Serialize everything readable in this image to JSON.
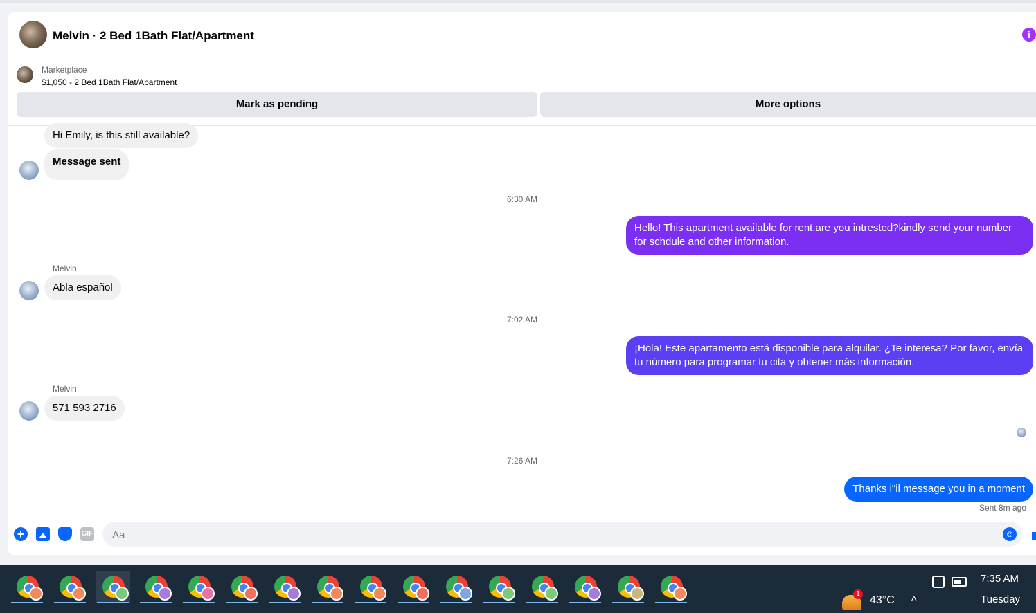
{
  "header": {
    "title": "Melvin · 2 Bed 1Bath Flat/Apartment",
    "info_icon": "i"
  },
  "marketplace": {
    "label": "Marketplace",
    "listing": "$1,050 - 2 Bed 1Bath Flat/Apartment",
    "mark_pending_label": "Mark as pending",
    "more_options_label": "More options"
  },
  "messages": [
    {
      "direction": "in",
      "text": "Hi Emily, is this still available?"
    },
    {
      "direction": "in",
      "text": "Message sent"
    },
    {
      "timestamp": "6:30 AM"
    },
    {
      "direction": "out",
      "text": "Hello! This apartment available for rent.are you intrested?kindly send your number for schdule and other information."
    },
    {
      "direction": "in",
      "sender": "Melvin",
      "text": "Abla español"
    },
    {
      "timestamp": "7:02 AM"
    },
    {
      "direction": "out",
      "text": "¡Hola! Este apartamento está disponible para alquilar. ¿Te interesa? Por favor, envía tu número para programar tu cita y obtener más información."
    },
    {
      "direction": "in",
      "sender": "Melvin",
      "text": "571 593 2716"
    },
    {
      "timestamp": "7:26 AM"
    },
    {
      "direction": "out",
      "text": "Thanks i\"il message you in a moment"
    }
  ],
  "sent_status": "Sent 8m ago",
  "composer": {
    "placeholder": "Aa",
    "gif_label": "GIF",
    "plus_glyph": "+",
    "emoji_glyph": "☺"
  },
  "taskbar": {
    "weather_badge": "1",
    "temperature": "43°C",
    "chevron_glyph": "^",
    "time": "7:35 AM",
    "day": "Tuesday",
    "apps": [
      {
        "badge_color": "#f08a5d"
      },
      {
        "badge_color": "#f08a5d"
      },
      {
        "badge_color": "#7bc97b",
        "active": true
      },
      {
        "badge_color": "#a77bdb"
      },
      {
        "badge_color": "#e572a8"
      },
      {
        "badge_color": "#f07060"
      },
      {
        "badge_color": "#a77bdb"
      },
      {
        "badge_color": "#f08a5d"
      },
      {
        "badge_color": "#f08a5d"
      },
      {
        "badge_color": "#f07060"
      },
      {
        "badge_color": "#7ea6e0"
      },
      {
        "badge_color": "#7bc97b"
      },
      {
        "badge_color": "#7bc97b"
      },
      {
        "badge_color": "#a77bdb"
      },
      {
        "badge_color": "#c9b77b"
      },
      {
        "badge_color": "#f08a5d"
      }
    ]
  },
  "colors": {
    "outgoing_purple": "#7b2ff2",
    "outgoing_blue": "#0866ff",
    "incoming": "#f0f0f0",
    "accent_info": "#a033ff"
  }
}
